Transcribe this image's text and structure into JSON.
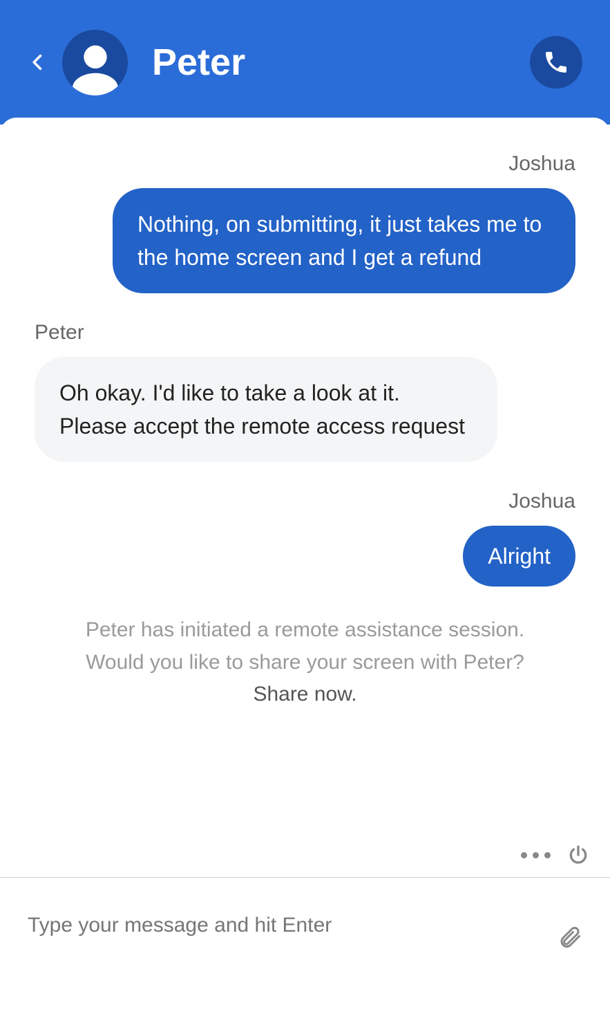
{
  "header": {
    "title": "Peter"
  },
  "messages": [
    {
      "sender": "Joshua",
      "side": "right",
      "text": "Nothing, on submitting, it just takes me to the home screen and I get a refund"
    },
    {
      "sender": "Peter",
      "side": "left",
      "text": "Oh okay. I'd like to take a look at it. Please accept the remote access request"
    },
    {
      "sender": "Joshua",
      "side": "right",
      "text": "Alright"
    }
  ],
  "system": {
    "line1": "Peter has initiated a remote assistance session.",
    "line2": "Would you like to share your screen with Peter?",
    "action": "Share now."
  },
  "input": {
    "placeholder": "Type your message and hit Enter"
  }
}
